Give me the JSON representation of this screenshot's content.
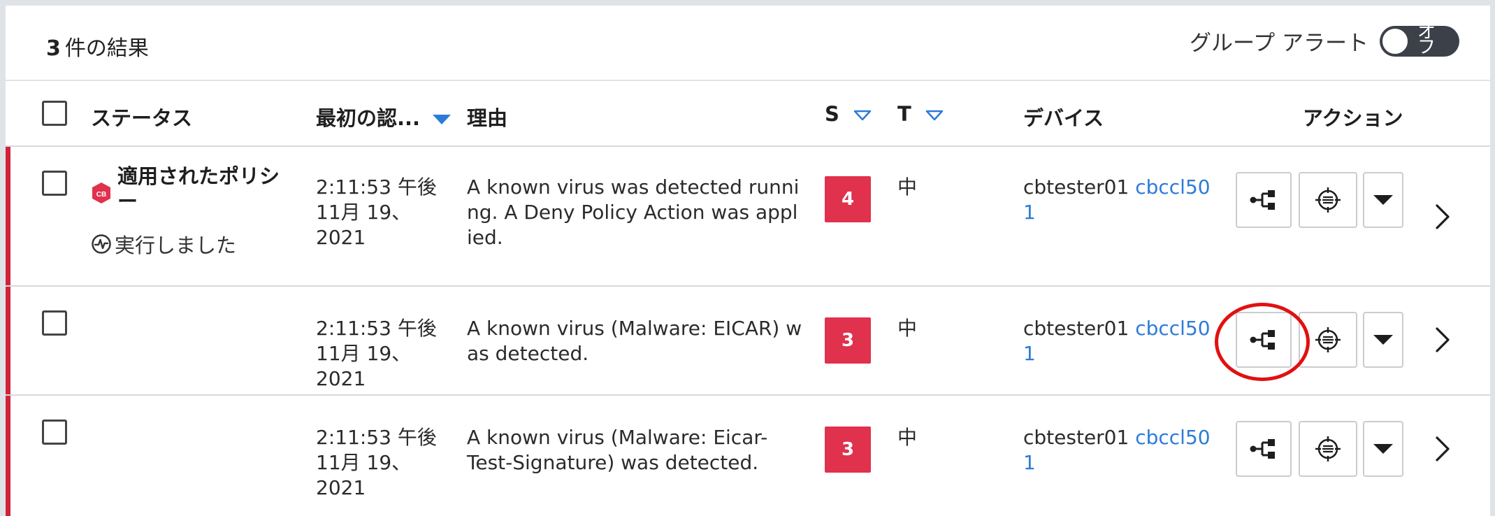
{
  "toolbar": {
    "result_count": "3",
    "result_suffix": "件の結果",
    "group_alert_label": "グループ アラート",
    "toggle_state": "オフ"
  },
  "columns": {
    "status": "ステータス",
    "first_seen": "最初の認...",
    "reason": "理由",
    "severity": "S",
    "threat": "T",
    "device": "デバイス",
    "actions": "アクション"
  },
  "rows": [
    {
      "status_title": "適用されたポリシー",
      "status_sub": "実行しました",
      "time": "2:11:53 午後",
      "date": "11月 19、2021",
      "reason": "A known virus was detected running. A Deny Policy Action was applied.",
      "severity": "4",
      "threat": "中",
      "device_user": "cbtester01",
      "device_link": "cbccl501"
    },
    {
      "status_title": "",
      "status_sub": "",
      "time": "2:11:53 午後",
      "date": "11月 19、2021",
      "reason": "A known virus (Malware: EICAR) was detected.",
      "severity": "3",
      "threat": "中",
      "device_user": "cbtester01",
      "device_link": "cbccl501"
    },
    {
      "status_title": "",
      "status_sub": "",
      "time": "2:11:53 午後",
      "date": "11月 19、2021",
      "reason": "A known virus (Malware: Eicar-Test-Signature) was detected.",
      "severity": "3",
      "threat": "中",
      "device_user": "cbtester01",
      "device_link": "cbccl501"
    }
  ],
  "colors": {
    "accent": "#2d7bd8",
    "severity": "#e0314d",
    "alert_bar": "#d0233a",
    "highlight": "#e21010"
  }
}
